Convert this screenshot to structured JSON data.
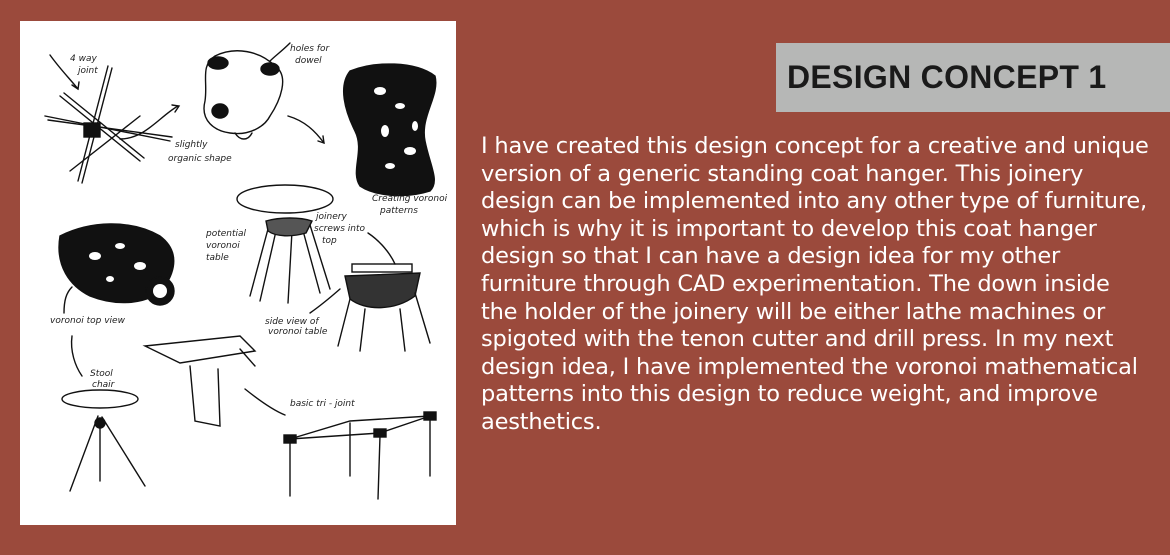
{
  "title": "DESIGN CONCEPT 1",
  "body": "I have created this design concept for a creative and unique version of a generic standing coat hanger. This joinery design can be implemented into any other type of furniture, which is why it is important to develop this coat hanger design so that I can have a design idea for my other furniture through CAD experimentation. The down inside the holder of the joinery will be either lathe machines or spigoted with the tenon cutter and drill press. In my next design idea, I have implemented the voronoi mathematical patterns into this design to reduce weight, and improve aesthetics.",
  "sketch_labels": {
    "four_way": "4 way",
    "joint": "joint",
    "holes_for": "holes for",
    "dowel": "dowel",
    "slightly": "slightly",
    "organic_shape": "organic shape",
    "creating_voronoi": "Creating voronoi",
    "patterns": "patterns",
    "potential": "potential",
    "voronoi": "voronoi",
    "table": "table",
    "joinery": "joinery",
    "screws_into": "screws into",
    "top": "top",
    "voronoi_top_view": "voronoi top view",
    "side_view_of": "side view of",
    "voronoi_table": "voronoi table",
    "stool": "Stool",
    "chair": "chair",
    "basic_tri_joint": "basic tri - joint"
  }
}
